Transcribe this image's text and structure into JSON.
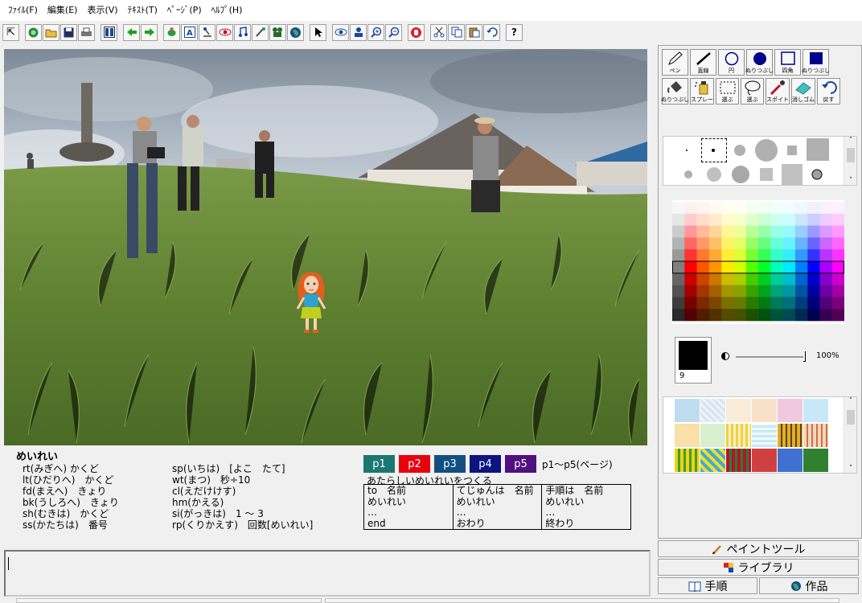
{
  "menu": [
    "ﾌｧｲﾙ(F)",
    "編集(E)",
    "表示(V)",
    "ﾃｷｽﾄ(T)",
    "ﾍﾟｰｼﾞ(P)",
    "ﾍﾙﾌﾟ(H)"
  ],
  "commands": {
    "header": "めいれい",
    "left": [
      "rt(みぎへ) かくど",
      "lt(ひだりへ)　かくど",
      "fd(まえへ)　きょり",
      "bk(うしろへ)　きょり",
      "sh(むきは)　かくど",
      "ss(かたちは)　番号"
    ],
    "right": [
      "sp(いちは)　[よこ　たて]",
      "wt(まつ)　秒÷10",
      "cl(えだけけす)",
      "hm(かえる)",
      "si(がっきは)　1 ～ 3",
      "rp(くりかえす)　回数[めいれい]"
    ]
  },
  "pages": {
    "buttons": [
      "p1",
      "p2",
      "p3",
      "p4",
      "p5"
    ],
    "colors": [
      "#1a7870",
      "#e8000c",
      "#105080",
      "#0c1480",
      "#501080"
    ],
    "note": "p1～p5(ページ)"
  },
  "new_turtle": "あたらしいめいれいをつくる",
  "templates": [
    [
      "to　名前",
      "めいれい",
      "…",
      "end"
    ],
    [
      "てじゅんは　名前",
      "めいれい",
      "…",
      "おわり"
    ],
    [
      "手順は　名前",
      "めいれい",
      "…",
      "終わり"
    ]
  ],
  "paint_tools": [
    {
      "label": "ペン",
      "icon": "pen-icon"
    },
    {
      "label": "直線",
      "icon": "line-icon"
    },
    {
      "label": "円",
      "icon": "circle-icon"
    },
    {
      "label": "ぬりつぶし",
      "icon": "filled-circle-icon"
    },
    {
      "label": "四角",
      "icon": "rectangle-icon"
    },
    {
      "label": "ぬりつぶし",
      "icon": "filled-rectangle-icon"
    },
    {
      "label": "ぬりつぶし",
      "icon": "paint-bucket-icon"
    },
    {
      "label": "スプレー",
      "icon": "spray-icon"
    },
    {
      "label": "選ぶ",
      "icon": "select-rect-icon"
    },
    {
      "label": "選ぶ",
      "icon": "lasso-icon"
    },
    {
      "label": "スポイト",
      "icon": "eyedropper-icon"
    },
    {
      "label": "消しゴム",
      "icon": "eraser-icon"
    },
    {
      "label": "戻す",
      "icon": "undo-icon"
    }
  ],
  "current_color": {
    "value": "#000000",
    "number": "9"
  },
  "opacity": "100%",
  "side_tabs": {
    "paint": "ペイントツール",
    "library": "ライブラリ",
    "procedure": "手順",
    "works": "作品"
  }
}
